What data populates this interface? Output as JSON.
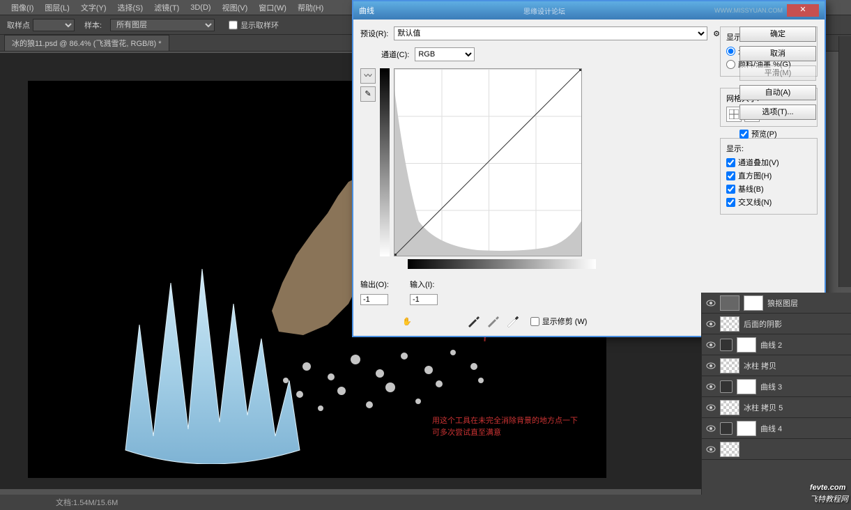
{
  "menubar": [
    "图像(I)",
    "图层(L)",
    "文字(Y)",
    "选择(S)",
    "滤镜(T)",
    "3D(D)",
    "视图(V)",
    "窗口(W)",
    "帮助(H)"
  ],
  "optionbar": {
    "sample_label": "取样点",
    "sample_value": "",
    "sample2_label": "样本:",
    "sample2_value": "所有图层",
    "ring_label": "显示取样环"
  },
  "tab": "冰的狼11.psd @ 86.4% (飞溅雪花, RGB/8) *",
  "statusbar": "文档:1.54M/15.6M",
  "dialog": {
    "title": "曲线",
    "preset_label": "预设(R):",
    "preset_value": "默认值",
    "channel_label": "通道(C):",
    "channel_value": "RGB",
    "output_label": "输出(O):",
    "output_value": "-1",
    "input_label": "输入(I):",
    "input_value": "-1",
    "clip_label": "显示修剪 (W)",
    "ok": "确定",
    "cancel": "取消",
    "smooth": "平滑(M)",
    "auto": "自动(A)",
    "options": "选项(T)...",
    "preview": "预览(P)",
    "display_amount_title": "显示数量:",
    "light_label": "光 (0-255)(L)",
    "pigment_label": "颜料/油墨 %(G)",
    "grid_title": "网格大小:",
    "show_title": "显示:",
    "show_channel": "通道叠加(V)",
    "show_hist": "直方图(H)",
    "show_base": "基线(B)",
    "show_inter": "交叉线(N)"
  },
  "annotation": {
    "line1": "用这个工具在未完全消除背景的地方点一下",
    "line2": "可多次尝试直至满意"
  },
  "layers": [
    {
      "name": "狼抠图层",
      "thumb": "img",
      "mask": true
    },
    {
      "name": "后面的阴影",
      "thumb": "trans"
    },
    {
      "name": "曲线 2",
      "thumb": "adj",
      "mask": true
    },
    {
      "name": "冰柱 拷贝",
      "thumb": "trans"
    },
    {
      "name": "曲线 3",
      "thumb": "adj",
      "mask": true
    },
    {
      "name": "冰柱 拷贝 5",
      "thumb": "trans"
    },
    {
      "name": "曲线 4",
      "thumb": "adj",
      "mask": true
    },
    {
      "name": "",
      "thumb": "trans"
    }
  ],
  "watermark": {
    "brand": "fevte.com",
    "sub": "飞特教程网",
    "top_text": "思缘设计论坛",
    "top_url": "WWW.MISSYUAN.COM"
  }
}
